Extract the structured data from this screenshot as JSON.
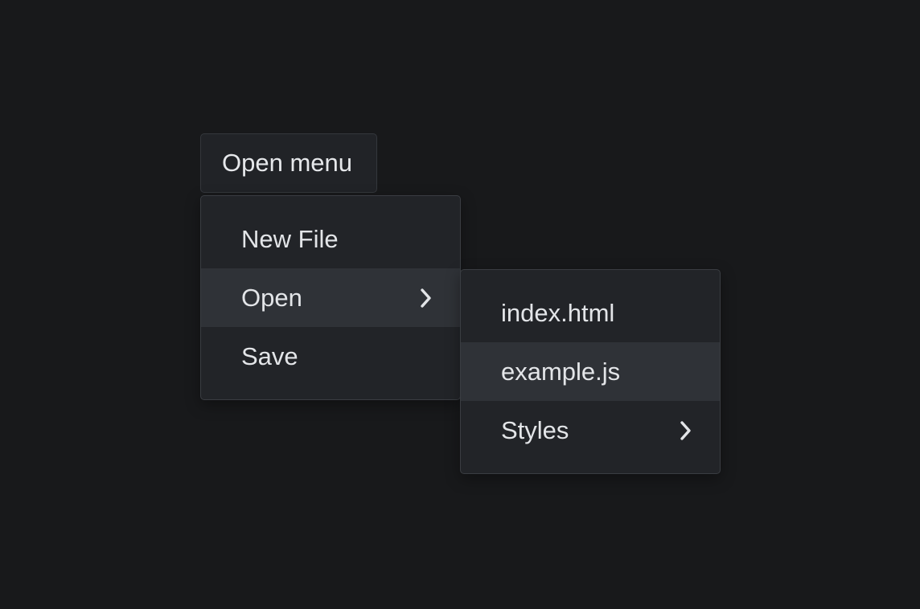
{
  "trigger": {
    "label": "Open menu"
  },
  "main_menu": {
    "items": [
      {
        "label": "New File",
        "active": false,
        "has_submenu": false
      },
      {
        "label": "Open",
        "active": true,
        "has_submenu": true
      },
      {
        "label": "Save",
        "active": false,
        "has_submenu": false
      }
    ]
  },
  "sub_menu": {
    "items": [
      {
        "label": "index.html",
        "active": false,
        "has_submenu": false
      },
      {
        "label": "example.js",
        "active": true,
        "has_submenu": false
      },
      {
        "label": "Styles",
        "active": false,
        "has_submenu": true
      }
    ]
  },
  "icons": {
    "submenu_indicator": "chevron-right-icon"
  },
  "colors": {
    "background": "#18191b",
    "menu_surface": "#222428",
    "active_item": "#2f3237",
    "text": "#e3e5e8"
  }
}
